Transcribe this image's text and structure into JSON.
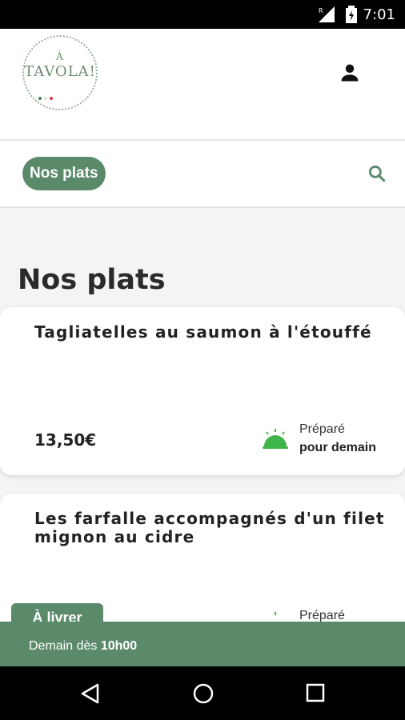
{
  "status_bar": {
    "time": "7:01",
    "network": "R"
  },
  "header": {
    "logo_top": "À",
    "logo_main": "TAVOLA!",
    "logo_flag_colors": [
      "#3a8a4a",
      "#e6e6e6",
      "#d83a3a"
    ]
  },
  "nav": {
    "pill_label": "Nos plats"
  },
  "page": {
    "title": "Nos plats"
  },
  "dishes": [
    {
      "name": "Tagliatelles au saumon à l'étouffé",
      "price": "13,50€",
      "prep_line1": "Préparé",
      "prep_line2": "pour demain"
    },
    {
      "name": "Les farfalle accompagnés d'un filet mignon au cidre",
      "price": "",
      "prep_line1": "Préparé",
      "prep_line2": ""
    }
  ],
  "delivery": {
    "tab_label": "À livrer",
    "prefix": "Demain dès",
    "time": "10h00"
  },
  "colors": {
    "accent": "#5b8a6b",
    "cloche": "#3fb54a"
  }
}
